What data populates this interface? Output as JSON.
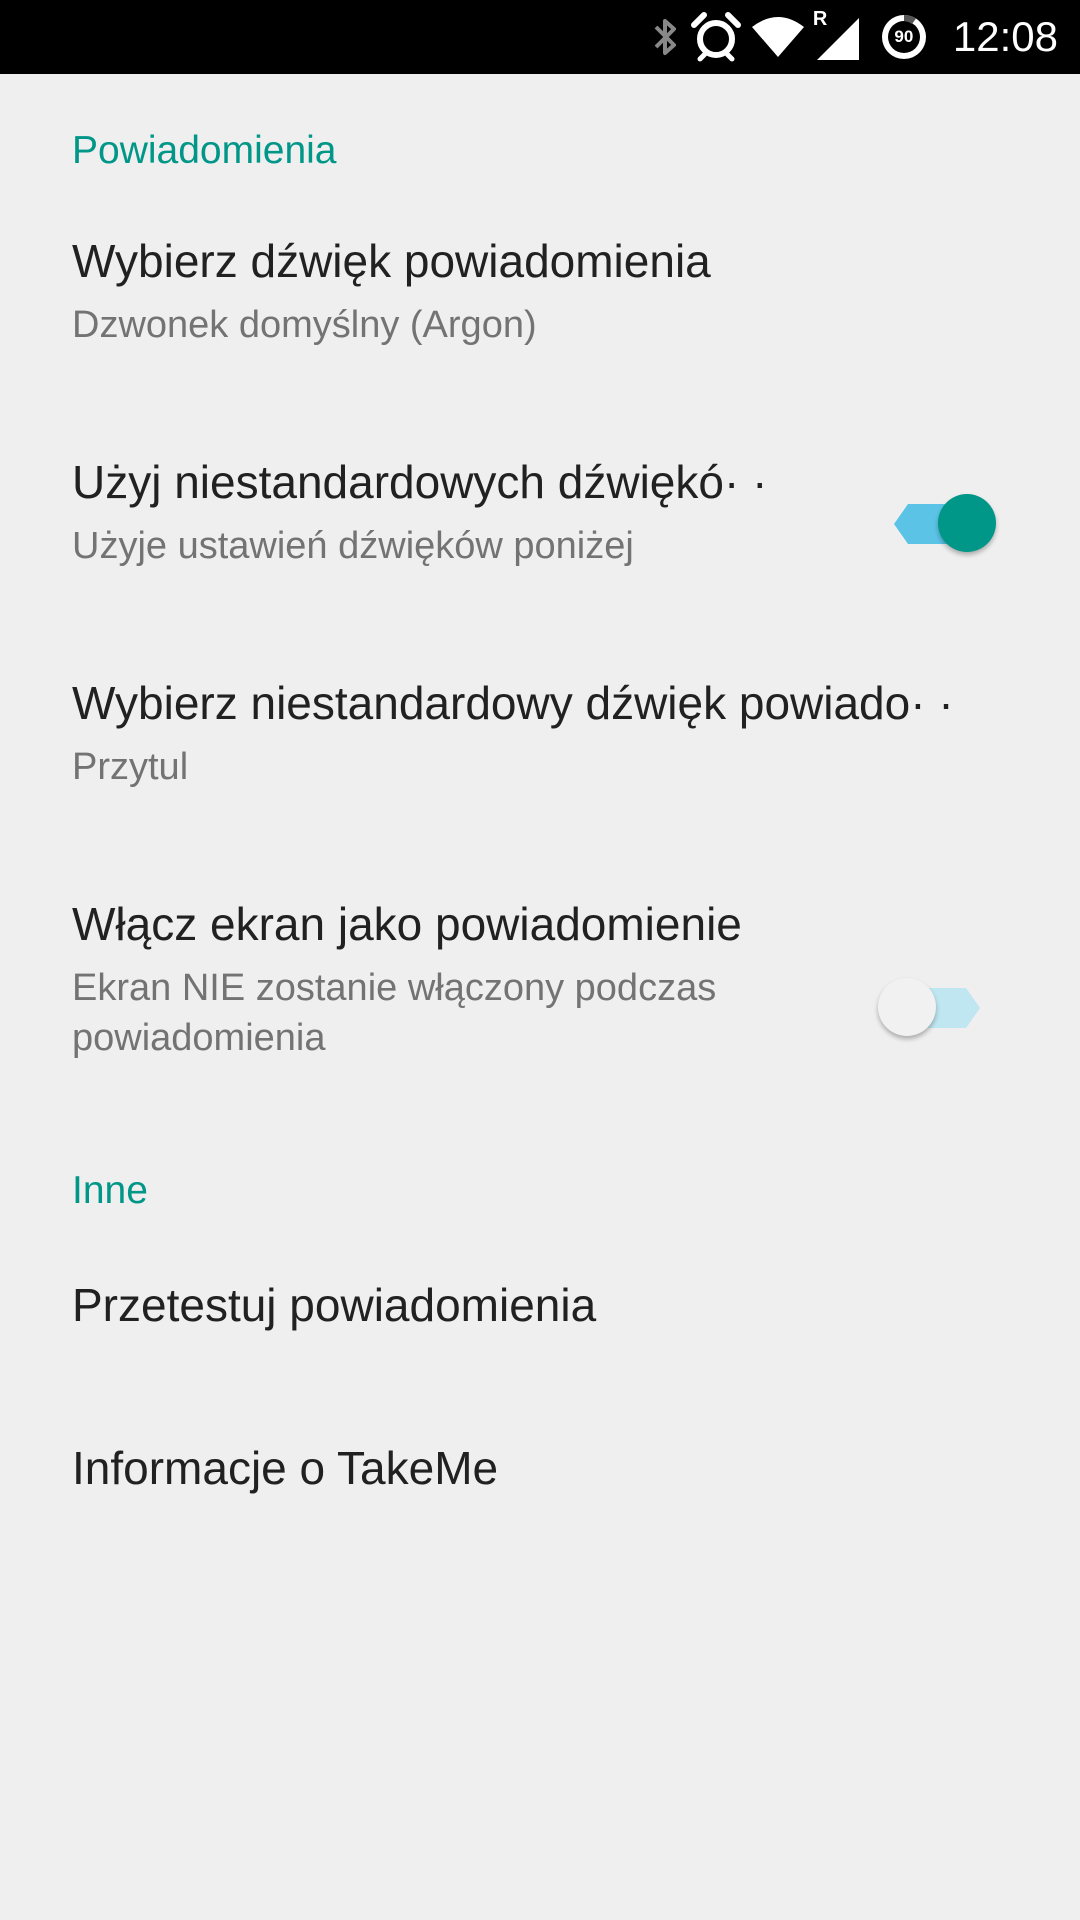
{
  "status_bar": {
    "time": "12:08",
    "battery_level": "90",
    "network_roaming": "R",
    "icons": [
      "bluetooth-icon",
      "alarm-icon",
      "wifi-icon",
      "signal-icon",
      "battery-icon"
    ]
  },
  "sections": {
    "notifications_header": "Powiadomienia",
    "other_header": "Inne"
  },
  "prefs": {
    "choose_sound": {
      "title": "Wybierz dźwięk powiadomienia",
      "summary": "Dzwonek domyślny (Argon)"
    },
    "custom_sounds": {
      "title": "Użyj niestandardowych dźwiękó",
      "summary": "Użyje ustawień dźwięków poniżej",
      "enabled": true
    },
    "custom_sound": {
      "title": "Wybierz niestandardowy dźwięk powiado",
      "summary": "Przytul"
    },
    "screen_on": {
      "title": "Włącz ekran jako powiadomienie",
      "summary": "Ekran NIE zostanie włączony podczas powiadomienia",
      "enabled": false
    },
    "test": {
      "title": "Przetestuj powiadomienia"
    },
    "about": {
      "title": "Informacje o TakeMe"
    }
  },
  "colors": {
    "accent": "#009688",
    "switch_on_track": "#5bc4e6",
    "switch_off_track": "#bfe6f1",
    "switch_off_thumb": "#f1f1f1",
    "background": "#efefef",
    "title_text": "#212121",
    "summary_text": "#737373"
  }
}
